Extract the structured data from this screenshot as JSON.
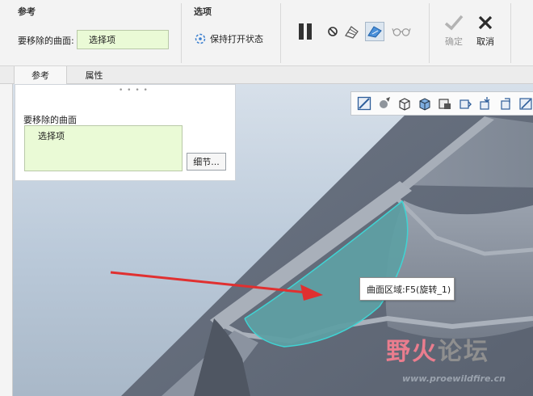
{
  "ribbon": {
    "reference_group": {
      "title": "参考",
      "surfaces_label": "要移除的曲面:",
      "select_value": "选择项"
    },
    "options_group": {
      "title": "选项",
      "keep_open_label": "保持打开状态"
    },
    "confirm_label": "确定",
    "cancel_label": "取消"
  },
  "tabs": [
    {
      "label": "参考",
      "active": true
    },
    {
      "label": "属性",
      "active": false
    }
  ],
  "panel": {
    "surfaces_label": "要移除的曲面",
    "select_value": "选择项",
    "details_button": "细节..."
  },
  "view_toolbar": {
    "icons": [
      "refit-icon",
      "repaint-icon",
      "saved-orientations-icon",
      "appearance-icon",
      "view-manager-icon",
      "display-style-icon",
      "datum-display-icon",
      "spin-center-icon",
      "annotation-display-icon"
    ]
  },
  "tooltip": {
    "text": "曲面区域:F5(旋转_1)"
  },
  "watermark": {
    "brand_fire": "野火",
    "brand_forum": "论坛",
    "url": "www.proewildfire.cn"
  },
  "colors": {
    "selection_green": "#eafad6",
    "highlight_surface": "#5f9fa3",
    "highlight_edge": "#3fd4d4",
    "arrow_red": "#e03030"
  }
}
